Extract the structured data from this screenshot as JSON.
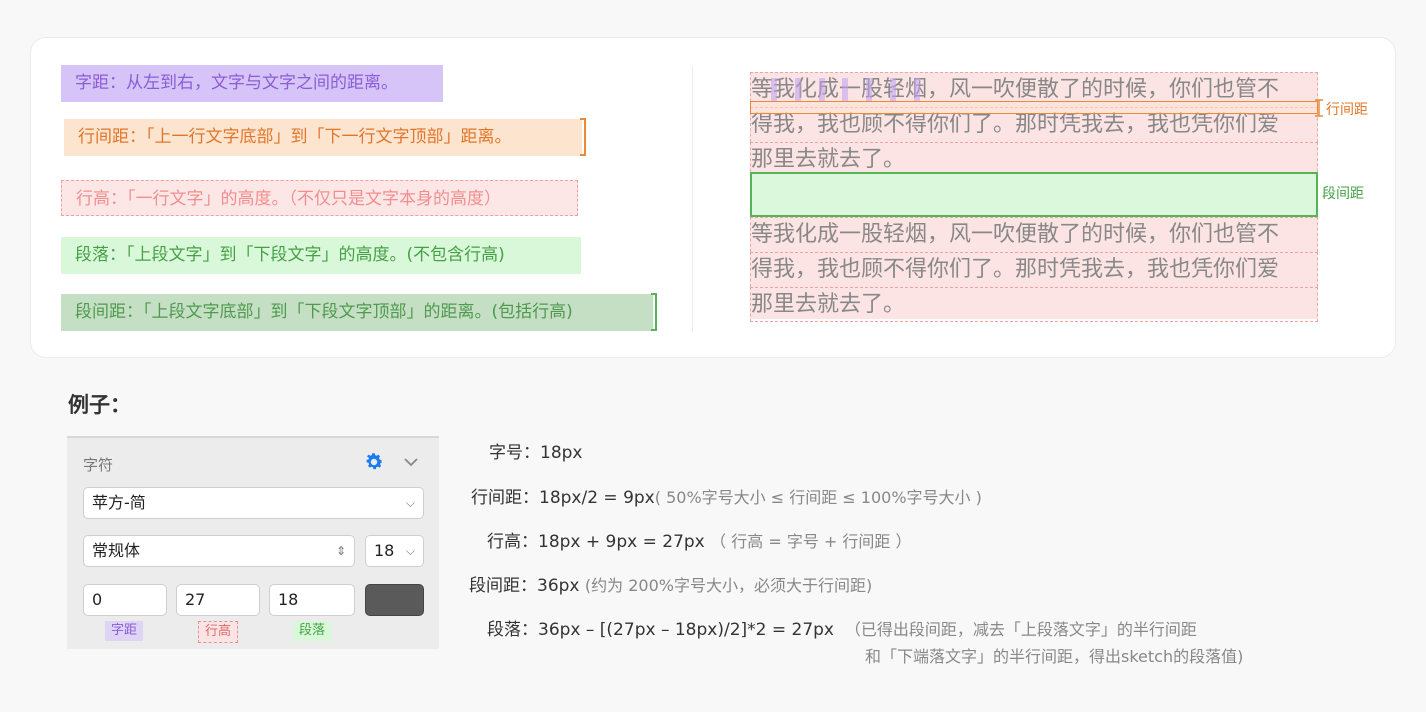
{
  "definitions": {
    "letter_spacing": "字距：从左到右，文字与文字之间的距离。",
    "line_gap": "行间距：「上一行文字底部」到「下一行文字顶部」距离。",
    "line_height": "行高：「一行文字」的高度。（不仅只是文字本身的高度）",
    "paragraph": "段落：「上段文字」到「下段文字」的高度。(不包含行高)",
    "paragraph_gap": "段间距：「上段文字底部」到「下段文字顶部」的距离。(包括行高)"
  },
  "sample": {
    "p1": [
      "等我化成一股轻烟，风一吹便散了的时候，你们也管不",
      "得我，我也顾不得你们了。那时凭我去，我也凭你们爱",
      "那里去就去了。"
    ],
    "p2": [
      "等我化成一股轻烟，风一吹便散了的时候，你们也管不",
      "得我，我也顾不得你们了。那时凭我去，我也凭你们爱",
      "那里去就去了。"
    ],
    "line_gap_label": "行间距",
    "para_gap_label": "段间距"
  },
  "example_title": "例子：",
  "panel": {
    "title": "字符",
    "font": "苹方-简",
    "weight": "常规体",
    "size": "18",
    "letter_spacing": "0",
    "line_height": "27",
    "paragraph_spacing": "18",
    "tag_ls": "字距",
    "tag_lh": "行高",
    "tag_ps": "段落",
    "color_swatch": "#5a5a5a"
  },
  "rows": {
    "r1_label": "字号：",
    "r1_value": "18px",
    "r2_label": "行间距：",
    "r2_value": "18px/2 = 9px",
    "r2_note": "( 50%字号大小 ≤ 行间距 ≤ 100%字号大小 )",
    "r3_label": "行高：",
    "r3_value": "18px + 9px = 27px",
    "r3_note": "（ 行高 = 字号 + 行间距 ）",
    "r4_label": "段间距：",
    "r4_value": "36px",
    "r4_note": "(约为 200%字号大小，必须大于行间距)",
    "r5_label": "段落：",
    "r5_value": "36px – [(27px – 18px)/2]*2 = 27px",
    "r5_note": "（已得出段间距，减去「上段落文字」的半行间距",
    "r5_note2": "和「下端落文字」的半行间距，得出sketch的段落值)"
  }
}
